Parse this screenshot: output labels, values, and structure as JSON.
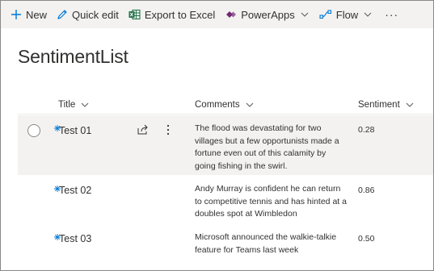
{
  "toolbar": {
    "new_label": "New",
    "quick_edit_label": "Quick edit",
    "export_label": "Export to Excel",
    "powerapps_label": "PowerApps",
    "flow_label": "Flow",
    "more_label": "···"
  },
  "list": {
    "title": "SentimentList",
    "columns": {
      "title": "Title",
      "comments": "Comments",
      "sentiment": "Sentiment"
    },
    "rows": [
      {
        "title": "Test 01",
        "comment": "The flood was devastating for two villages but a few opportunists made a fortune even out of this calamity by going fishing in the swirl.",
        "sentiment": "0.28"
      },
      {
        "title": "Test 02",
        "comment": "Andy Murray is confident he can return to competitive tennis and has hinted at a doubles spot at Wimbledon",
        "sentiment": "0.86"
      },
      {
        "title": "Test 03",
        "comment": "Microsoft announced the walkie-talkie feature for Teams last week",
        "sentiment": "0.50"
      }
    ]
  },
  "colors": {
    "accent": "#0078d4",
    "command_bar_bg": "#f3f2f1",
    "selected_row_bg": "#f3f2f1",
    "text": "#323130"
  },
  "icons": [
    "plus-icon",
    "pencil-icon",
    "excel-icon",
    "powerapps-icon",
    "flow-icon",
    "chevron-down-icon",
    "share-icon",
    "more-vertical-icon",
    "new-item-indicator-icon"
  ]
}
